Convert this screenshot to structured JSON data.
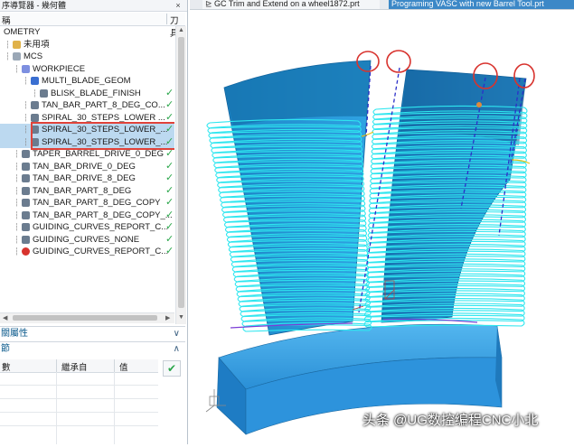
{
  "navigator": {
    "title": "序導覽器 - 幾何體",
    "close": "×",
    "col_name": "稱",
    "col_tool": "刀具",
    "rows": [
      {
        "label": "OMETRY",
        "indent": 0,
        "icon": "none",
        "check": false,
        "sel": false
      },
      {
        "label": "未用項",
        "indent": 1,
        "icon": "folder-icon",
        "check": false,
        "sel": false
      },
      {
        "label": "MCS",
        "indent": 1,
        "icon": "mcs-icon",
        "check": false,
        "sel": false
      },
      {
        "label": "WORKPIECE",
        "indent": 2,
        "icon": "workpiece-icon",
        "check": false,
        "sel": false
      },
      {
        "label": "MULTI_BLADE_GEOM",
        "indent": 3,
        "icon": "blade-geom-icon",
        "check": false,
        "sel": false
      },
      {
        "label": "BLISK_BLADE_FINISH",
        "indent": 4,
        "icon": "operation-icon",
        "check": true,
        "sel": false
      },
      {
        "label": "TAN_BAR_PART_8_DEG_CO...",
        "indent": 3,
        "icon": "operation-icon",
        "check": true,
        "sel": false
      },
      {
        "label": "SPIRAL_30_STEPS_LOWER ...",
        "indent": 3,
        "icon": "operation-icon",
        "check": true,
        "sel": false
      },
      {
        "label": "SPIRAL_30_STEPS_LOWER_...",
        "indent": 3,
        "icon": "operation-icon",
        "check": true,
        "sel": true
      },
      {
        "label": "SPIRAL_30_STEPS_LOWER_...",
        "indent": 3,
        "icon": "operation-icon",
        "check": true,
        "sel": true
      },
      {
        "label": "TAPER_BARREL_DRIVE_0_DEG",
        "indent": 2,
        "icon": "operation-icon",
        "check": true,
        "sel": false
      },
      {
        "label": "TAN_BAR_DRIVE_0_DEG",
        "indent": 2,
        "icon": "operation-icon",
        "check": true,
        "sel": false
      },
      {
        "label": "TAN_BAR_DRIVE_8_DEG",
        "indent": 2,
        "icon": "operation-icon",
        "check": true,
        "sel": false
      },
      {
        "label": "TAN_BAR_PART_8_DEG",
        "indent": 2,
        "icon": "operation-icon",
        "check": true,
        "sel": false
      },
      {
        "label": "TAN_BAR_PART_8_DEG_COPY",
        "indent": 2,
        "icon": "operation-icon",
        "check": true,
        "sel": false
      },
      {
        "label": "TAN_BAR_PART_8_DEG_COPY_...",
        "indent": 2,
        "icon": "operation-icon",
        "check": true,
        "sel": false
      },
      {
        "label": "GUIDING_CURVES_REPORT_C...",
        "indent": 2,
        "icon": "operation-icon",
        "check": true,
        "sel": false
      },
      {
        "label": "GUIDING_CURVES_NONE",
        "indent": 2,
        "icon": "operation-icon",
        "check": true,
        "sel": false
      },
      {
        "label": "GUIDING_CURVES_REPORT_C...",
        "indent": 2,
        "icon": "error-operation-icon",
        "check": true,
        "sel": false
      }
    ]
  },
  "panels": {
    "dependencies": "關屬性",
    "details": "節",
    "cols": [
      "數",
      "繼承自",
      "值"
    ],
    "chevron_down": "∨",
    "chevron_up": "∧"
  },
  "tabs": [
    {
      "label": "GC Trim and Extend on a wheel1872.prt",
      "icon": "part-file-icon"
    },
    {
      "label": "Programing VASC with new Barrel Tool.prt",
      "active": true
    }
  ],
  "watermark": "头条 @UG数控编程CNC小北",
  "colors": {
    "selection": "#bcd9f0",
    "highlight_box": "#e0433a",
    "check": "#2aa64a",
    "tab_active": "#3c88c7",
    "blade": "#1f9ad8",
    "toolpath": "#2ee6ef",
    "hub": "#2f96e0"
  }
}
